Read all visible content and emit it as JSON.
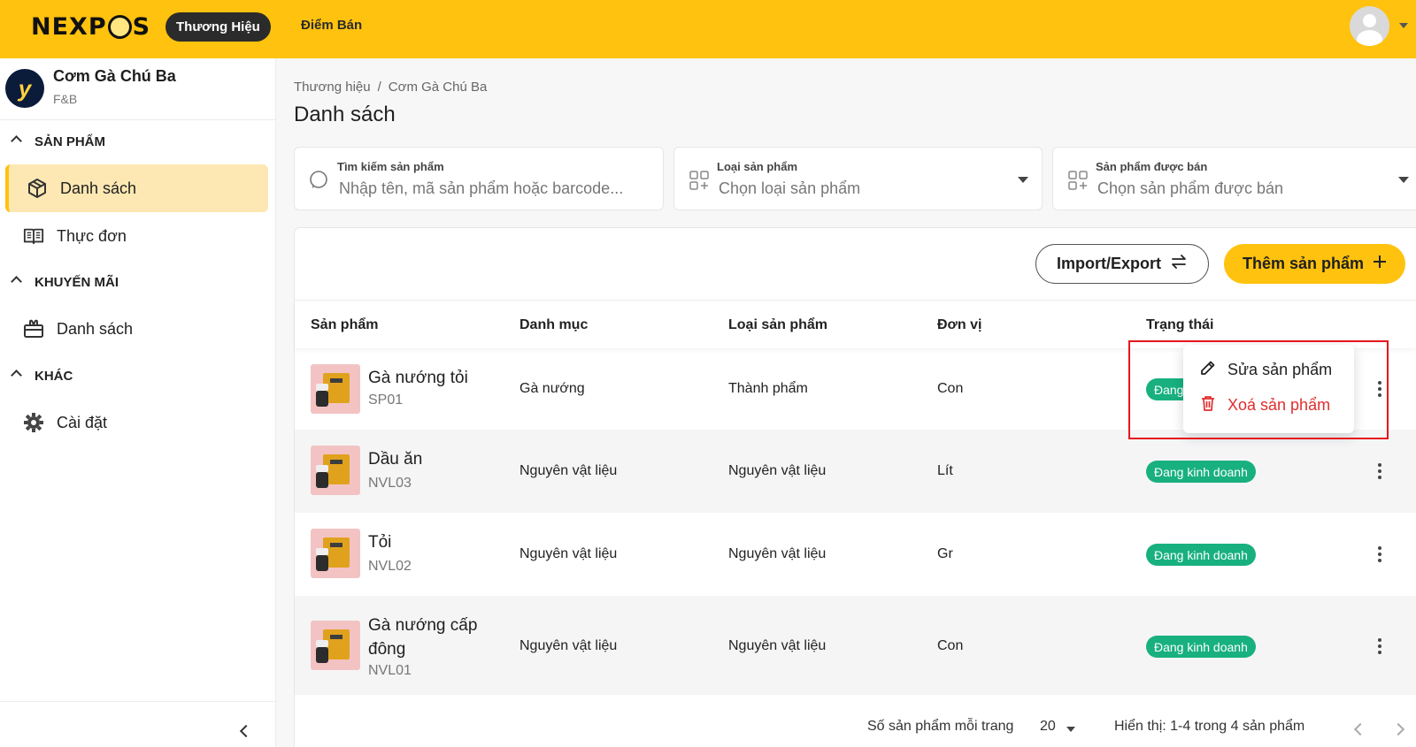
{
  "header": {
    "logo": "NEXPOS",
    "tabs": [
      {
        "label": "Thương Hiệu",
        "active": true
      },
      {
        "label": "Điểm Bán",
        "active": false
      }
    ],
    "accent_color": "#ffc20e"
  },
  "sidebar": {
    "store": {
      "name": "Cơm Gà Chú Ba",
      "type": "F&B",
      "logo_letter": "y"
    },
    "sections": [
      {
        "title": "SẢN PHẨM",
        "items": [
          {
            "label": "Danh sách",
            "icon": "cube-icon",
            "active": true
          },
          {
            "label": "Thực đơn",
            "icon": "book-icon",
            "active": false
          }
        ]
      },
      {
        "title": "KHUYẾN MÃI",
        "items": [
          {
            "label": "Danh sách",
            "icon": "gift-icon",
            "active": false
          }
        ]
      },
      {
        "title": "KHÁC",
        "items": [
          {
            "label": "Cài đặt",
            "icon": "gear-icon",
            "active": false
          }
        ]
      }
    ]
  },
  "breadcrumb": {
    "items": [
      "Thương hiệu",
      "Cơm Gà Chú Ba"
    ],
    "separator": "/"
  },
  "page": {
    "title": "Danh sách"
  },
  "filters": {
    "search": {
      "label": "Tìm kiếm sản phẩm",
      "placeholder": "Nhập tên, mã sản phẩm hoặc barcode..."
    },
    "type": {
      "label": "Loại sản phẩm",
      "placeholder": "Chọn loại sản phẩm"
    },
    "sellable": {
      "label": "Sản phẩm được bán",
      "placeholder": "Chọn sản phẩm được bán"
    }
  },
  "toolbar": {
    "import_export": "Import/Export",
    "add_product": "Thêm sản phẩm"
  },
  "table": {
    "columns": [
      "Sản phẩm",
      "Danh mục",
      "Loại sản phẩm",
      "Đơn vị",
      "Trạng thái"
    ],
    "rows": [
      {
        "name": "Gà nướng tỏi",
        "code": "SP01",
        "category": "Gà nướng",
        "type": "Thành phẩm",
        "unit": "Con",
        "status": "Đang kinh doanh"
      },
      {
        "name": "Dầu ăn",
        "code": "NVL03",
        "category": "Nguyên vật liệu",
        "type": "Nguyên vật liệu",
        "unit": "Lít",
        "status": "Đang kinh doanh"
      },
      {
        "name": "Tỏi",
        "code": "NVL02",
        "category": "Nguyên vật liệu",
        "type": "Nguyên vật liệu",
        "unit": "Gr",
        "status": "Đang kinh doanh"
      },
      {
        "name": "Gà nướng cấp đông",
        "code": "NVL01",
        "category": "Nguyên vật liệu",
        "type": "Nguyên vật liệu",
        "unit": "Con",
        "status": "Đang kinh doanh"
      }
    ],
    "status_color": "#18b07f"
  },
  "context_menu": {
    "edit": "Sửa sản phẩm",
    "delete": "Xoá sản phẩm",
    "delete_color": "#e02e2e"
  },
  "pagination": {
    "per_page_label": "Số sản phẩm mỗi trang",
    "per_page_value": "20",
    "summary": "Hiển thị: 1-4 trong 4 sản phẩm"
  }
}
